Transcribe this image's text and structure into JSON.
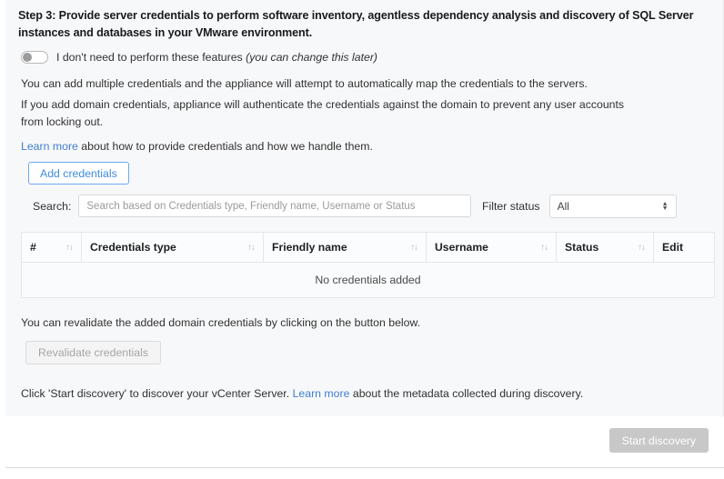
{
  "step": {
    "title": "Step 3: Provide server credentials to perform software inventory, agentless dependency analysis and discovery of SQL Server instances and databases in your VMware environment."
  },
  "toggle": {
    "label": "I don't need to perform these features ",
    "hint": "(you can change this later)",
    "state": "off"
  },
  "paragraphs": {
    "p1": "You can add multiple credentials and the appliance will attempt to automatically map the credentials to the servers.",
    "p2": "If you add domain credentials, appliance will authenticate the credentials against  the domain to prevent any user accounts from locking out.",
    "p3_link": "Learn more",
    "p3_rest": " about how to provide credentials and how we handle them."
  },
  "buttons": {
    "add_credentials": "Add credentials",
    "revalidate_credentials": "Revalidate credentials",
    "start_discovery": "Start discovery"
  },
  "search": {
    "label": "Search:",
    "value": "",
    "placeholder": "Search based on Credentials type, Friendly name, Username or Status"
  },
  "filter": {
    "label": "Filter status",
    "selected": "All",
    "options": [
      "All"
    ]
  },
  "table": {
    "columns": [
      {
        "label": "#",
        "sort": "↑↓"
      },
      {
        "label": "Credentials type",
        "sort": "↑↓"
      },
      {
        "label": "Friendly name",
        "sort": "↑↓"
      },
      {
        "label": "Username",
        "sort": "↑↓"
      },
      {
        "label": "Status",
        "sort": "↑↓"
      },
      {
        "label": "Edit",
        "sort": ""
      }
    ],
    "rows": [],
    "empty_message": "No credentials added"
  },
  "revalidate": {
    "text": "You can revalidate the added domain credentials by clicking on the button below."
  },
  "discovery": {
    "text_before": "Click 'Start discovery' to discover your vCenter Server. ",
    "link": "Learn more",
    "text_after": " about the metadata collected during discovery."
  },
  "colors": {
    "link": "#3f7fd0",
    "accent_border": "#6aabf0",
    "panel_bg": "#f7f8fa",
    "disabled_button": "#c8c8c8"
  }
}
